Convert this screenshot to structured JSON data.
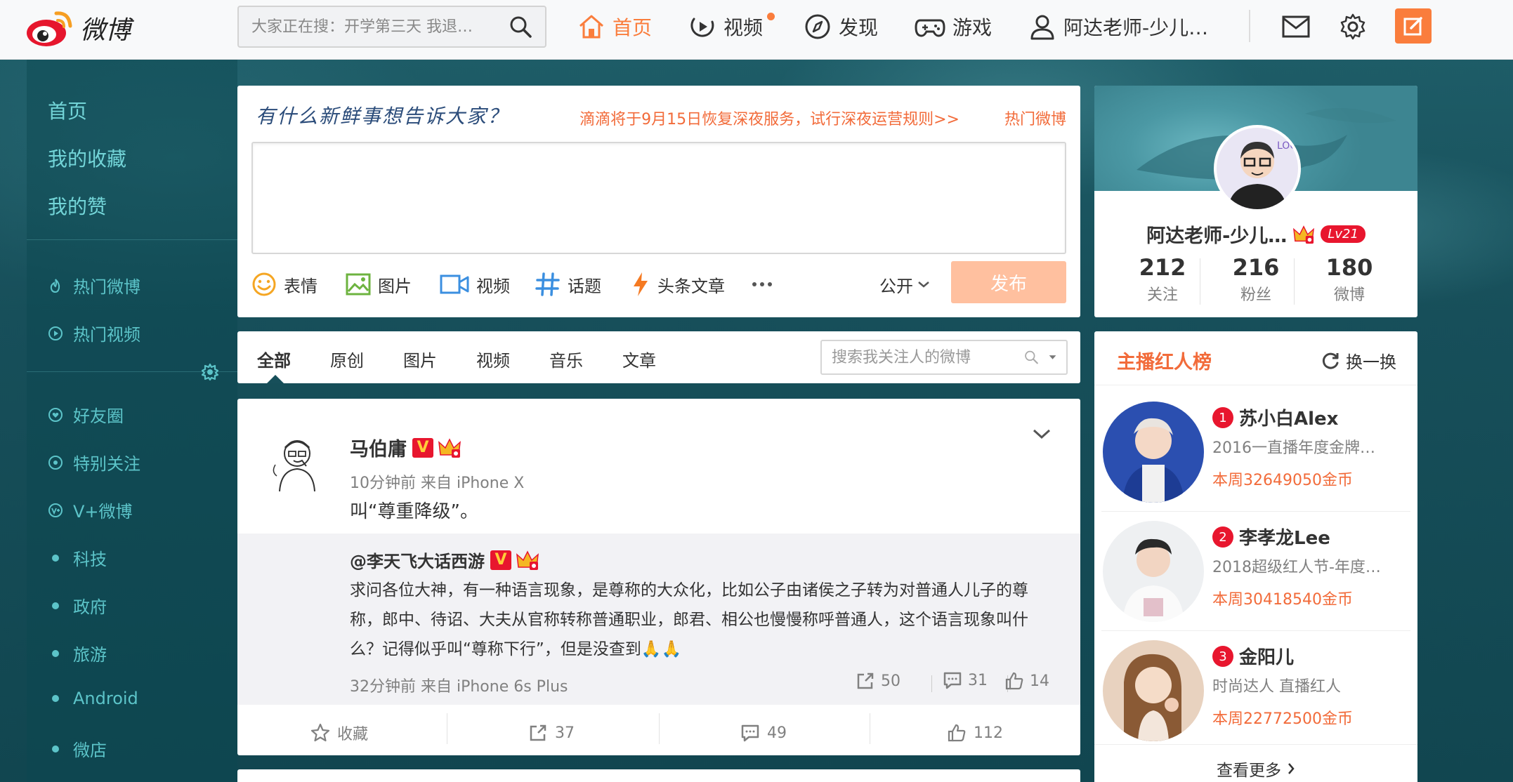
{
  "topbar": {
    "logo_text": "微博",
    "search_placeholder": "大家正在搜：开学第三天 我退…",
    "nav": [
      {
        "label": "首页"
      },
      {
        "label": "视频"
      },
      {
        "label": "发现"
      },
      {
        "label": "游戏"
      },
      {
        "label": "阿达老师-少儿…"
      }
    ]
  },
  "sidebar": {
    "primary": [
      "首页",
      "我的收藏",
      "我的赞"
    ],
    "secondary": [
      "热门微博",
      "热门视频"
    ],
    "groups": [
      "好友圈",
      "特别关注",
      "V+微博"
    ],
    "topics": [
      "科技",
      "政府",
      "旅游",
      "Android",
      "微店"
    ]
  },
  "composer": {
    "title": "有什么新鲜事想告诉大家？",
    "news": "滴滴将于9月15日恢复深夜服务，试行深夜运营规则>>",
    "hot_link": "热门微博",
    "tools": [
      "表情",
      "图片",
      "视频",
      "话题",
      "头条文章"
    ],
    "privacy": "公开",
    "publish": "发布"
  },
  "filter": {
    "tabs": [
      "全部",
      "原创",
      "图片",
      "视频",
      "音乐",
      "文章"
    ],
    "search_placeholder": "搜索我关注人的微博"
  },
  "post": {
    "author": "马伯庸",
    "v_badge": "V",
    "meta": "10分钟前 来自 iPhone X",
    "text": "叫“尊重降级”。",
    "repost": {
      "author": "@李天飞大话西游",
      "v_badge": "V",
      "text": "求问各位大神，有一种语言现象，是尊称的大众化，比如公子由诸侯之子转为对普通人儿子的尊称，郎中、待诏、大夫从官称转称普通职业，郎君、相公也慢慢称呼普通人，这个语言现象叫什么？记得似乎叫“尊称下行”，但是没查到🙏🙏",
      "meta": "32分钟前 来自 iPhone 6s Plus",
      "shares": "50",
      "comments": "31",
      "likes": "14"
    },
    "actions": {
      "favorite": "收藏",
      "shares": "37",
      "comments": "49",
      "likes": "112"
    }
  },
  "profile": {
    "name": "阿达老师-少儿…",
    "level": "Lv21",
    "stats": [
      {
        "value": "212",
        "label": "关注"
      },
      {
        "value": "216",
        "label": "粉丝"
      },
      {
        "value": "180",
        "label": "微博"
      }
    ]
  },
  "ranking": {
    "title": "主播红人榜",
    "refresh": "换一换",
    "items": [
      {
        "rank": "1",
        "name": "苏小白Alex",
        "desc": "2016一直播年度金牌…",
        "gold": "本周32649050金币"
      },
      {
        "rank": "2",
        "name": "李孝龙Lee",
        "desc": "2018超级红人节-年度…",
        "gold": "本周30418540金币"
      },
      {
        "rank": "3",
        "name": "金阳儿",
        "desc": "时尚达人 直播红人",
        "gold": "本周22772500金币"
      }
    ],
    "more": "查看更多"
  },
  "colors": {
    "accent": "#fa7d3c",
    "link_red": "#f26b3a",
    "sidebar_text": "#6ad0d4",
    "badge_red": "#e8162e"
  }
}
